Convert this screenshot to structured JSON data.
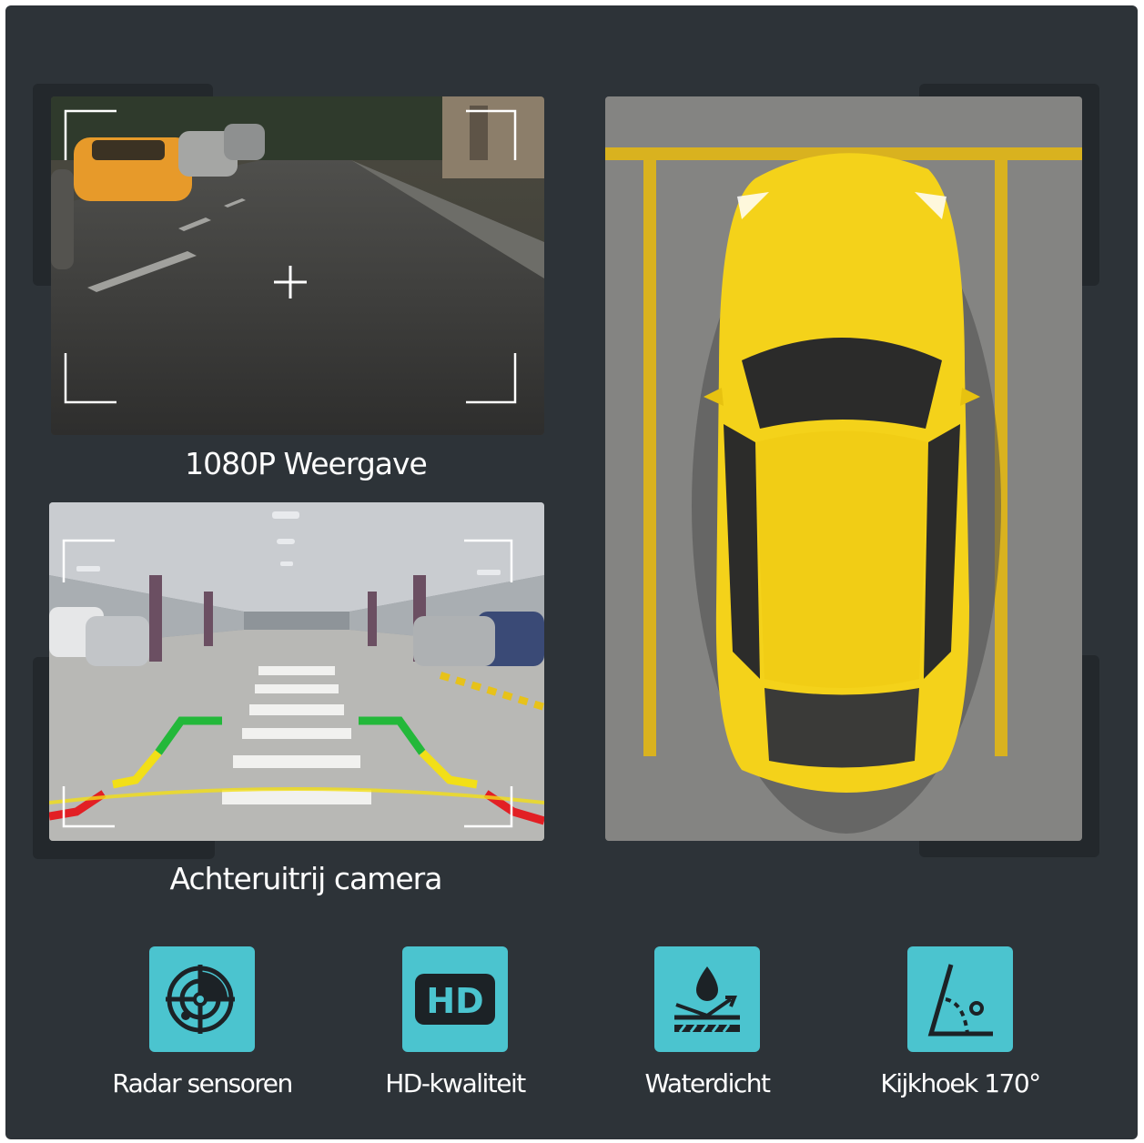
{
  "captions": {
    "display": "1080P Weergave",
    "reverse": "Achteruitrij camera"
  },
  "features": [
    {
      "label": "Radar sensoren",
      "icon": "radar-icon"
    },
    {
      "label": "HD-kwaliteit",
      "icon": "hd-icon"
    },
    {
      "label": "Waterdicht",
      "icon": "waterproof-icon"
    },
    {
      "label": "Kijkhoek 170°",
      "icon": "angle-icon"
    }
  ],
  "colors": {
    "background": "#2d3338",
    "icon_tile": "#4bc4cf",
    "car": "#f4d21a",
    "parking_line": "#d9b21f"
  }
}
